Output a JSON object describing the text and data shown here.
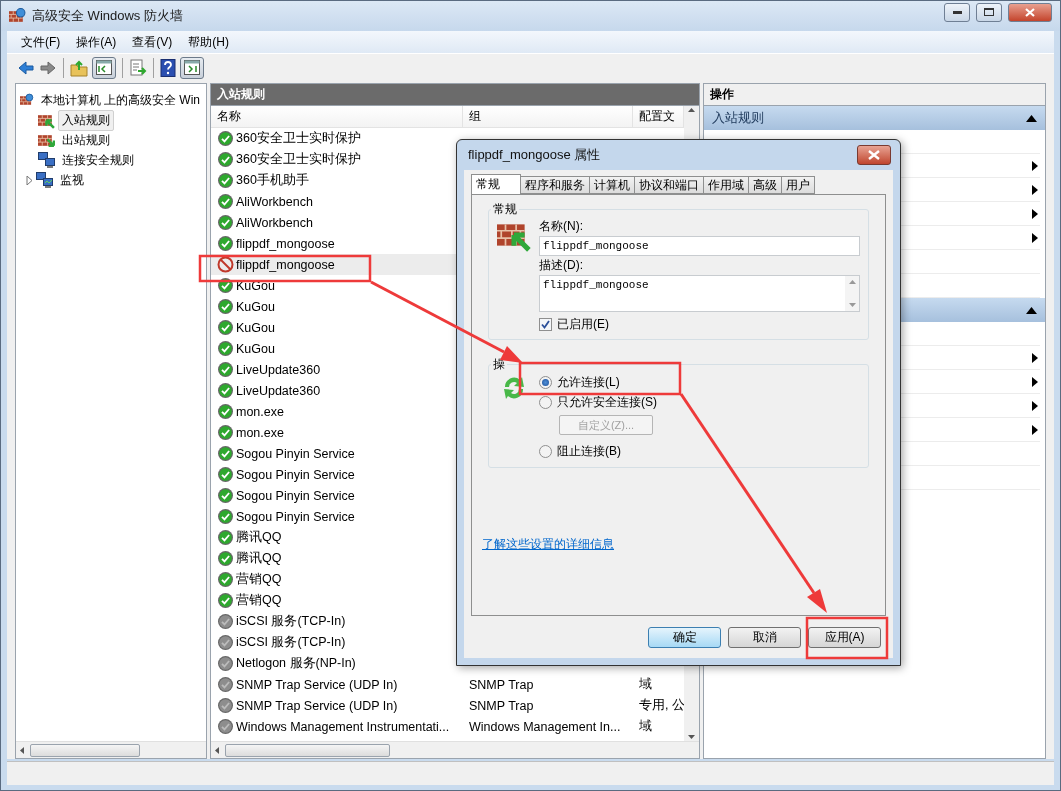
{
  "window": {
    "title": "高级安全 Windows 防火墙"
  },
  "menu": [
    "文件(F)",
    "操作(A)",
    "查看(V)",
    "帮助(H)"
  ],
  "toolbar": [
    {
      "kind": "back",
      "disabled": false
    },
    {
      "kind": "forward",
      "disabled": true
    },
    {
      "kind": "separator"
    },
    {
      "kind": "up",
      "disabled": false
    },
    {
      "kind": "tree-pane",
      "pressed": true
    },
    {
      "kind": "separator"
    },
    {
      "kind": "export",
      "disabled": false
    },
    {
      "kind": "separator"
    },
    {
      "kind": "help",
      "disabled": false
    },
    {
      "kind": "action-pane",
      "pressed": true
    }
  ],
  "tree": {
    "label": "本地计算机 上的高级安全 Win",
    "children": [
      {
        "label": "入站规则",
        "kind": "inbound",
        "selected": true
      },
      {
        "label": "出站规则",
        "kind": "outbound",
        "selected": false
      },
      {
        "label": "连接安全规则",
        "kind": "connection",
        "selected": false
      },
      {
        "label": "监视",
        "kind": "monitor",
        "selected": false,
        "expanded": false
      }
    ]
  },
  "rules": {
    "title": "入站规则",
    "columns": [
      "名称",
      "组",
      "配置文"
    ],
    "rows": [
      {
        "name": "360安全卫士实时保护",
        "kind": "allow",
        "enabled": true,
        "selected": false
      },
      {
        "name": "360安全卫士实时保护",
        "kind": "allow",
        "enabled": true,
        "selected": false
      },
      {
        "name": "360手机助手",
        "kind": "allow",
        "enabled": true,
        "selected": false
      },
      {
        "name": "AliWorkbench",
        "kind": "allow",
        "enabled": true,
        "selected": false
      },
      {
        "name": "AliWorkbench",
        "kind": "allow",
        "enabled": true,
        "selected": false
      },
      {
        "name": "flippdf_mongoose",
        "kind": "allow",
        "enabled": true,
        "selected": false
      },
      {
        "name": "flippdf_mongoose",
        "kind": "block",
        "enabled": true,
        "selected": true
      },
      {
        "name": "KuGou",
        "kind": "allow",
        "enabled": true,
        "selected": false
      },
      {
        "name": "KuGou",
        "kind": "allow",
        "enabled": true,
        "selected": false
      },
      {
        "name": "KuGou",
        "kind": "allow",
        "enabled": true,
        "selected": false
      },
      {
        "name": "KuGou",
        "kind": "allow",
        "enabled": true,
        "selected": false
      },
      {
        "name": "LiveUpdate360",
        "kind": "allow",
        "enabled": true,
        "selected": false
      },
      {
        "name": "LiveUpdate360",
        "kind": "allow",
        "enabled": true,
        "selected": false
      },
      {
        "name": "mon.exe",
        "kind": "allow",
        "enabled": true,
        "selected": false
      },
      {
        "name": "mon.exe",
        "kind": "allow",
        "enabled": true,
        "selected": false
      },
      {
        "name": "Sogou Pinyin Service",
        "kind": "allow",
        "enabled": true,
        "selected": false
      },
      {
        "name": "Sogou Pinyin Service",
        "kind": "allow",
        "enabled": true,
        "selected": false
      },
      {
        "name": "Sogou Pinyin Service",
        "kind": "allow",
        "enabled": true,
        "selected": false
      },
      {
        "name": "Sogou Pinyin Service",
        "kind": "allow",
        "enabled": true,
        "selected": false
      },
      {
        "name": "腾讯QQ",
        "kind": "allow",
        "enabled": true,
        "selected": false
      },
      {
        "name": "腾讯QQ",
        "kind": "allow",
        "enabled": true,
        "selected": false
      },
      {
        "name": "营销QQ",
        "kind": "allow",
        "enabled": true,
        "selected": false
      },
      {
        "name": "营销QQ",
        "kind": "allow",
        "enabled": true,
        "selected": false
      },
      {
        "name": "iSCSI 服务(TCP-In)",
        "kind": "allow",
        "enabled": false,
        "selected": false
      },
      {
        "name": "iSCSI 服务(TCP-In)",
        "kind": "allow",
        "enabled": false,
        "selected": false
      },
      {
        "name": "Netlogon 服务(NP-In)",
        "kind": "allow",
        "enabled": false,
        "selected": false
      },
      {
        "name": "SNMP Trap Service (UDP In)",
        "kind": "allow",
        "enabled": false,
        "selected": false,
        "group": "SNMP Trap",
        "profile": "域"
      },
      {
        "name": "SNMP Trap Service (UDP In)",
        "kind": "allow",
        "enabled": false,
        "selected": false,
        "group": "SNMP Trap",
        "profile": "专用, 公"
      },
      {
        "name": "Windows Management Instrumentati...",
        "kind": "allow",
        "enabled": false,
        "selected": false,
        "group": "Windows Management In...",
        "profile": "域"
      }
    ]
  },
  "actions": {
    "title": "操作",
    "sections": [
      {
        "title": "入站规则",
        "expanded": true
      },
      {
        "expanded": true
      }
    ]
  },
  "dialog": {
    "title": "flippdf_mongoose 属性",
    "tabs": [
      {
        "label": "常规",
        "selected": true
      },
      {
        "label": "程序和服务",
        "selected": false
      },
      {
        "label": "计算机",
        "selected": false
      },
      {
        "label": "协议和端口",
        "selected": false
      },
      {
        "label": "作用域",
        "selected": false
      },
      {
        "label": "高级",
        "selected": false
      },
      {
        "label": "用户",
        "selected": false
      }
    ],
    "general": {
      "title": "常规",
      "name_label": "名称(N):",
      "name_value": "flippdf_mongoose",
      "description_label": "描述(D):",
      "description_value": "flippdf_mongoose",
      "enabled": {
        "label": "已启用(E)",
        "checked": true
      }
    },
    "action": {
      "title": "操",
      "options": [
        {
          "label": "允许连接(L)",
          "selected": true
        },
        {
          "label": "只允许安全连接(S)",
          "selected": false
        },
        {
          "label": "阻止连接(B)",
          "selected": false
        }
      ],
      "customize": {
        "label": "自定义(Z)...",
        "disabled": true
      }
    },
    "link": "了解这些设置的详细信息",
    "buttons": [
      {
        "label": "确定",
        "default": true
      },
      {
        "label": "取消",
        "default": false
      },
      {
        "label": "应用(A)",
        "default": false
      }
    ]
  }
}
